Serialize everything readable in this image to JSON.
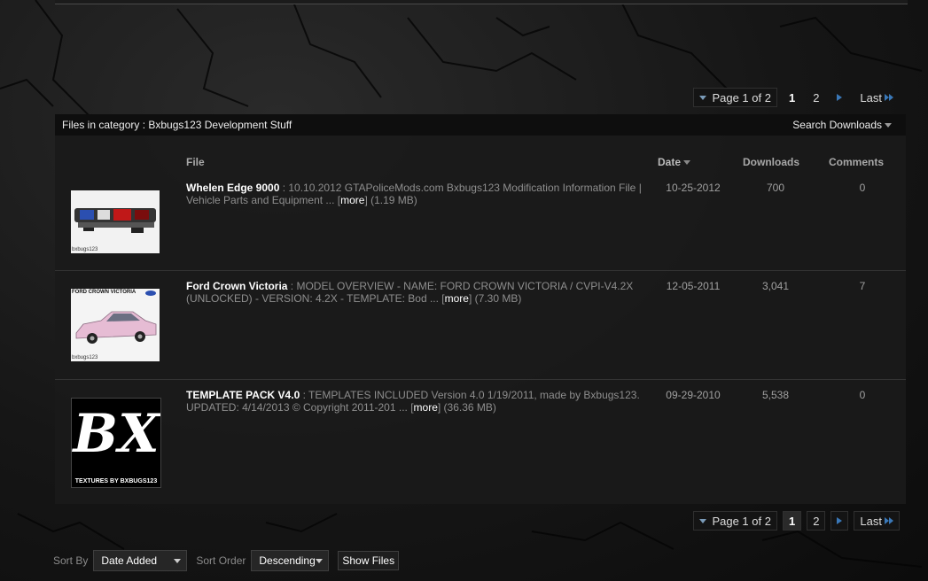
{
  "pagination": {
    "page_label": "Page 1 of 2",
    "pages": [
      "1",
      "2"
    ],
    "current": "1",
    "last_label": "Last"
  },
  "category": {
    "title": "Files in category : Bxbugs123 Development Stuff",
    "search_label": "Search Downloads"
  },
  "table": {
    "headers": {
      "file": "File",
      "date": "Date",
      "downloads": "Downloads",
      "comments": "Comments"
    },
    "rows": [
      {
        "name": "Whelen Edge 9000",
        "text": " : 10.10.2012 GTAPoliceMods.com Bxbugs123 Modification Information File | Vehicle Parts and Equipment ... [",
        "more": "more",
        "size": "] (1.19 MB)",
        "date": "10-25-2012",
        "downloads": "700",
        "comments": "0",
        "thumb_caption": "bxbugs123"
      },
      {
        "name": "Ford Crown Victoria",
        "text": " : MODEL OVERVIEW - NAME: FORD CROWN VICTORIA / CVPI-V4.2X (UNLOCKED) - VERSION: 4.2X - TEMPLATE: Bod ... [",
        "more": "more",
        "size": "] (7.30 MB)",
        "date": "12-05-2011",
        "downloads": "3,041",
        "comments": "7",
        "thumb_title": "FORD CROWN VICTORIA",
        "thumb_caption": "bxbugs123"
      },
      {
        "name": "TEMPLATE PACK V4.0",
        "text": " : TEMPLATES INCLUDED Version 4.0 1/19/2011, made by Bxbugs123. UPDATED: 4/14/2013 © Copyright 2011-201 ... [",
        "more": "more",
        "size": "] (36.36 MB)",
        "date": "09-29-2010",
        "downloads": "5,538",
        "comments": "0",
        "thumb_logo": "BX",
        "thumb_caption": "TEXTURES BY BXBUGS123"
      }
    ]
  },
  "sort": {
    "sort_by_label": "Sort By",
    "sort_by_value": "Date Added",
    "sort_order_label": "Sort Order",
    "sort_order_value": "Descending",
    "show_files_label": "Show Files"
  }
}
